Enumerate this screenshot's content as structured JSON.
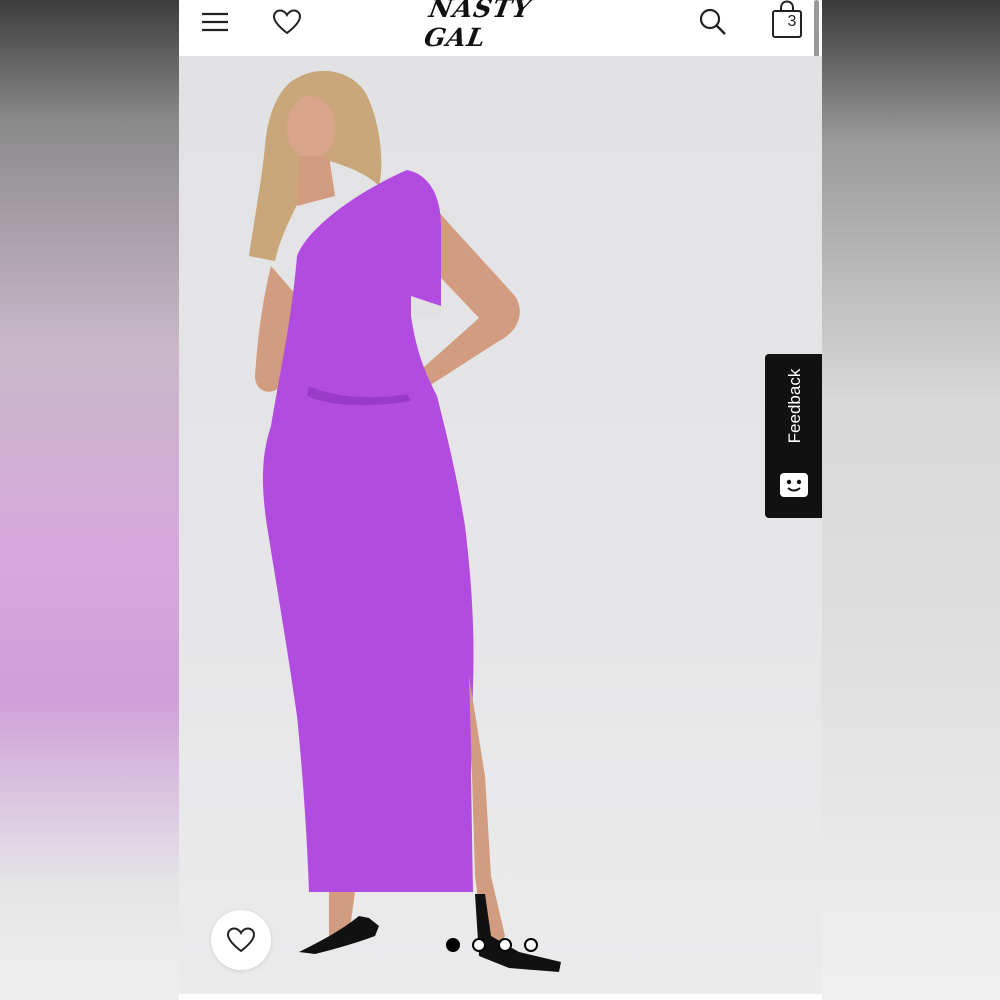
{
  "header": {
    "logo_text": "NASTY GAL",
    "bag_count": "3"
  },
  "feedback": {
    "label": "Feedback"
  },
  "carousel": {
    "total_slides": 4,
    "active_index": 0
  },
  "colors": {
    "dress": "#b24be0",
    "background": "#e4e4e6",
    "feedback_tab": "#111111"
  },
  "icons": [
    "menu-icon",
    "heart-icon",
    "search-icon",
    "bag-icon",
    "smiley-icon"
  ]
}
